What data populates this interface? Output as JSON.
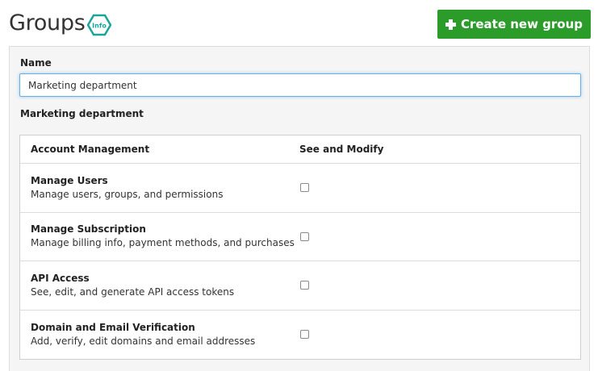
{
  "header": {
    "title": "Groups",
    "info_badge_text": "Info",
    "info_badge_color": "#1aa59a",
    "create_button_label": "Create new group",
    "create_button_color": "#2b9c2a"
  },
  "form": {
    "name_label": "Name",
    "name_value": "Marketing department",
    "group_heading": "Marketing department"
  },
  "permissions": {
    "headers": [
      "Account Management",
      "See and Modify"
    ],
    "rows": [
      {
        "title": "Manage Users",
        "description": "Manage users, groups, and permissions",
        "checked": false
      },
      {
        "title": "Manage Subscription",
        "description": "Manage billing info, payment methods, and purchases",
        "checked": false
      },
      {
        "title": "API Access",
        "description": "See, edit, and generate API access tokens",
        "checked": false
      },
      {
        "title": "Domain and Email Verification",
        "description": "Add, verify, edit domains and email addresses",
        "checked": false
      }
    ]
  }
}
